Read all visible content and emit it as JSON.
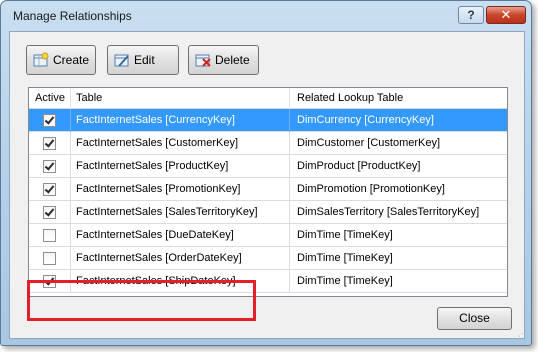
{
  "window": {
    "title": "Manage Relationships",
    "help_label": "?",
    "close_label": "✕"
  },
  "toolbar": {
    "create_label": "Create",
    "edit_label": "Edit",
    "delete_label": "Delete"
  },
  "grid": {
    "columns": [
      "Active",
      "Table",
      "Related Lookup Table"
    ],
    "rows": [
      {
        "active": true,
        "table": "FactInternetSales [CurrencyKey]",
        "lookup": "DimCurrency [CurrencyKey]",
        "selected": true
      },
      {
        "active": true,
        "table": "FactInternetSales [CustomerKey]",
        "lookup": "DimCustomer [CustomerKey]"
      },
      {
        "active": true,
        "table": "FactInternetSales [ProductKey]",
        "lookup": "DimProduct [ProductKey]"
      },
      {
        "active": true,
        "table": "FactInternetSales [PromotionKey]",
        "lookup": "DimPromotion [PromotionKey]"
      },
      {
        "active": true,
        "table": "FactInternetSales [SalesTerritoryKey]",
        "lookup": "DimSalesTerritory [SalesTerritoryKey]"
      },
      {
        "active": false,
        "table": "FactInternetSales [DueDateKey]",
        "lookup": "DimTime [TimeKey]"
      },
      {
        "active": false,
        "table": "FactInternetSales [OrderDateKey]",
        "lookup": "DimTime [TimeKey]"
      },
      {
        "active": true,
        "table": "FactInternetSales [ShipDateKey]",
        "lookup": "DimTime [TimeKey]"
      }
    ]
  },
  "footer": {
    "close_label": "Close"
  },
  "colors": {
    "selection": "#3399ff",
    "highlight": "#e2202a"
  }
}
